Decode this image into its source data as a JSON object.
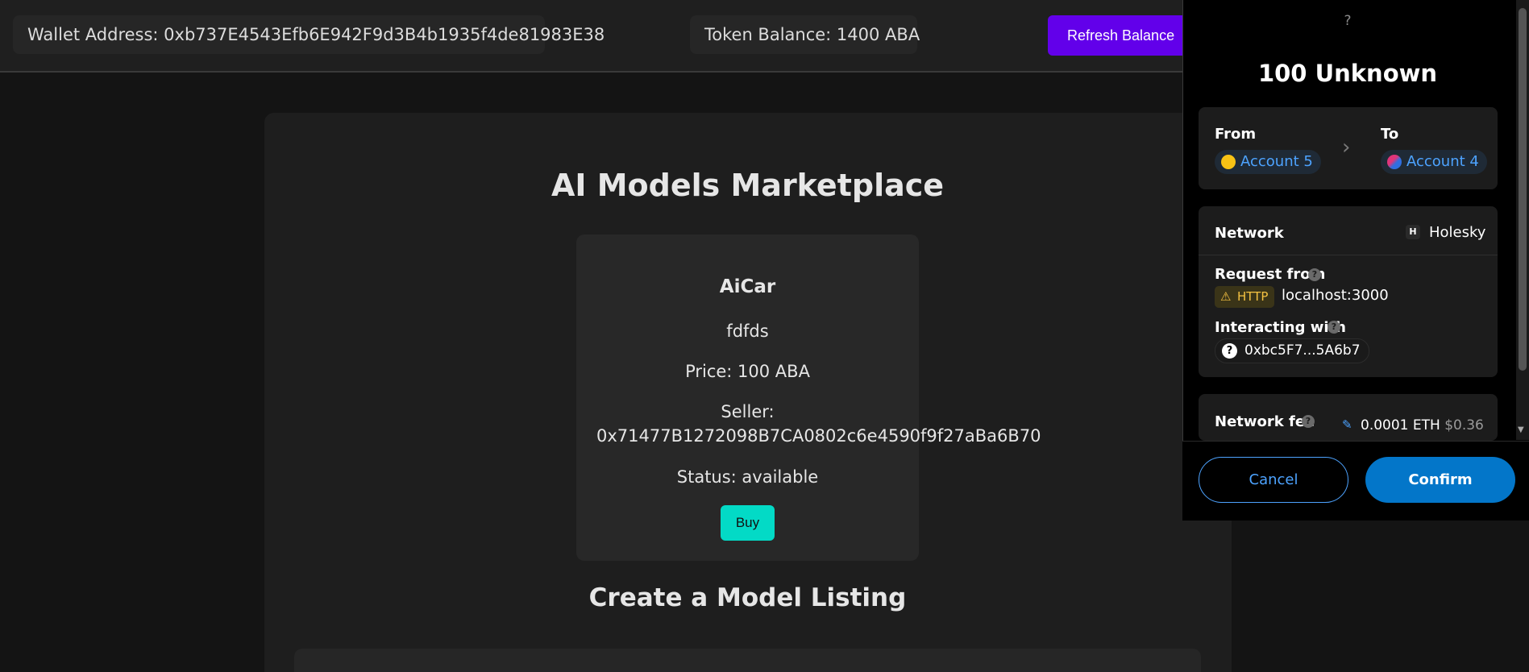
{
  "header": {
    "wallet_label": "Wallet Address: 0xb737E4543Efb6E942F9d3B4b1935f4de81983E38",
    "balance_label": "Token Balance: 1400 ABA",
    "refresh_label": "Refresh Balance"
  },
  "main": {
    "title": "AI Models Marketplace",
    "card": {
      "name": "AiCar",
      "description": "fdfds",
      "price": "Price: 100 ABA",
      "seller_label": "Seller:",
      "seller_address": "0x71477B1272098B7CA0802c6e4590f9f27aBa6B70",
      "status": "Status: available",
      "buy_label": "Buy"
    },
    "create_title": "Create a Model Listing"
  },
  "popup": {
    "help_glyph": "?",
    "amount": "100 Unknown",
    "from_label": "From",
    "from_account": "Account 5",
    "to_label": "To",
    "to_account": "Account 4",
    "network_label": "Network",
    "network_badge": "H",
    "network_value": "Holesky",
    "request_from_label": "Request from",
    "http_badge": "HTTP",
    "request_origin": "localhost:3000",
    "interacting_label": "Interacting with",
    "contract": "0xbc5F7...5A6b7",
    "fee_label": "Network fee",
    "fee_eth": "0.0001 ETH",
    "fee_usd": "$0.36",
    "cancel_label": "Cancel",
    "confirm_label": "Confirm"
  },
  "colors": {
    "accent_purple": "#6200ea",
    "buy_teal": "#03dac6",
    "metamask_blue": "#0376c9",
    "link_blue": "#4da3ff"
  },
  "icons": [
    "question-icon",
    "chevron-right-icon",
    "warning-icon",
    "help-circle-icon",
    "pencil-icon",
    "account-avatar-icon"
  ]
}
